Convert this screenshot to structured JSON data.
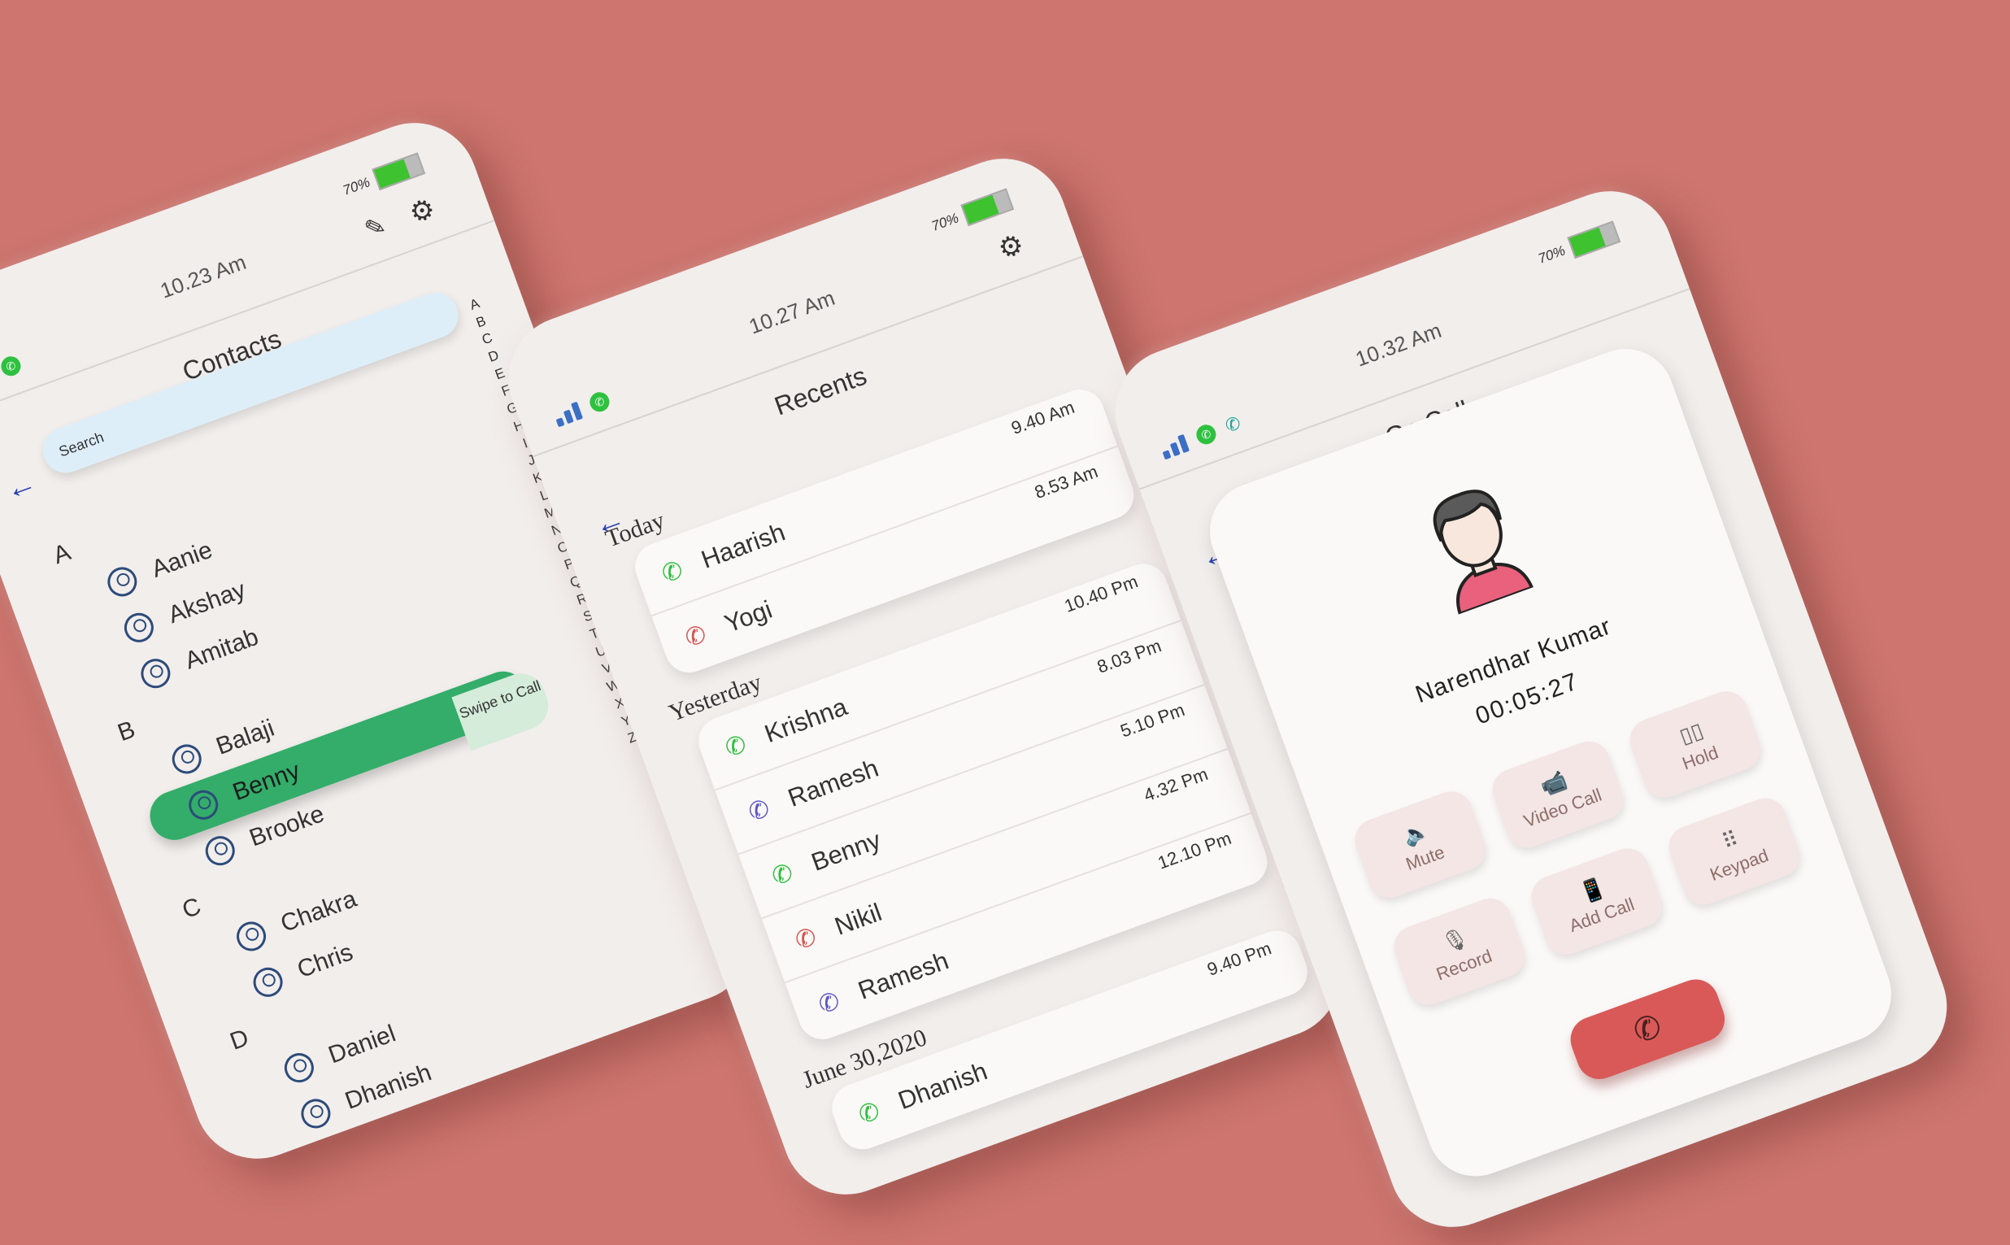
{
  "status": {
    "battery": "70%",
    "battery_level": 0.7
  },
  "colors": {
    "background": "#cd756e",
    "accent_green": "#33ad69",
    "end_call": "#d95959",
    "call_green": "#2ec13f",
    "call_red": "#d9534f",
    "call_blue": "#5c56c4"
  },
  "contacts_screen": {
    "time": "10.23 Am",
    "title": "Contacts",
    "search_placeholder": "Search",
    "alphabet": [
      "A",
      "B",
      "C",
      "D",
      "E",
      "F",
      "G",
      "H",
      "I",
      "J",
      "K",
      "L",
      "M",
      "N",
      "O",
      "P",
      "Q",
      "R",
      "S",
      "T",
      "U",
      "V",
      "W",
      "X",
      "Y",
      "Z"
    ],
    "groups": [
      {
        "letter": "A",
        "contacts": [
          "Aanie",
          "Akshay",
          "Amitab"
        ]
      },
      {
        "letter": "B",
        "contacts": [
          "Balaji",
          "Benny",
          "Brooke"
        ]
      },
      {
        "letter": "C",
        "contacts": [
          "Chakra",
          "Chris"
        ]
      },
      {
        "letter": "D",
        "contacts": [
          "Daniel",
          "Dhanish"
        ]
      }
    ],
    "swipe_hint": "Swipe to Call"
  },
  "recents_screen": {
    "time": "10.27 Am",
    "title": "Recents",
    "sections": [
      {
        "label": "Today",
        "calls": [
          {
            "name": "Haarish",
            "time": "9.40 Am",
            "type": "green"
          },
          {
            "name": "Yogi",
            "time": "8.53 Am",
            "type": "red"
          }
        ]
      },
      {
        "label": "Yesterday",
        "calls": [
          {
            "name": "Krishna",
            "time": "10.40 Pm",
            "type": "green"
          },
          {
            "name": "Ramesh",
            "time": "8.03 Pm",
            "type": "blue"
          },
          {
            "name": "Benny",
            "time": "5.10 Pm",
            "type": "green"
          },
          {
            "name": "Nikil",
            "time": "4.32 Pm",
            "type": "red"
          },
          {
            "name": "Ramesh",
            "time": "12.10 Pm",
            "type": "blue"
          }
        ]
      },
      {
        "label": "June 30,2020",
        "calls": [
          {
            "name": "Dhanish",
            "time": "9.40 Pm",
            "type": "green"
          }
        ]
      }
    ]
  },
  "oncall_screen": {
    "time": "10.32 Am",
    "title": "On Call",
    "caller_name": "Narendhar Kumar",
    "duration": "00:05:27",
    "buttons": [
      {
        "label": "Mute",
        "icon": "mute-icon",
        "glyph": "🔈"
      },
      {
        "label": "Video Call",
        "icon": "video-icon",
        "glyph": "📹"
      },
      {
        "label": "Hold",
        "icon": "pause-icon",
        "glyph": "▯▯"
      },
      {
        "label": "Record",
        "icon": "mic-icon",
        "glyph": "🎙"
      },
      {
        "label": "Add Call",
        "icon": "add-call-icon",
        "glyph": "📱"
      },
      {
        "label": "Keypad",
        "icon": "keypad-icon",
        "glyph": "⠿"
      }
    ]
  }
}
